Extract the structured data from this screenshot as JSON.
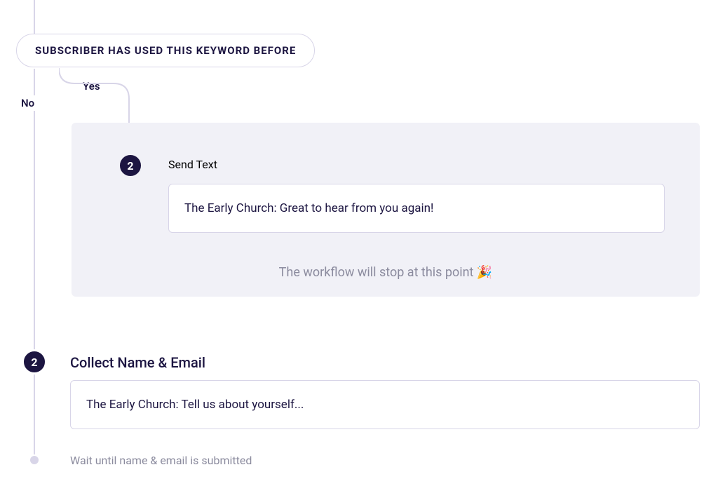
{
  "condition": {
    "label": "SUBSCRIBER HAS USED THIS KEYWORD BEFORE"
  },
  "branches": {
    "no_label": "No",
    "yes_label": "Yes"
  },
  "yes_branch": {
    "step_number": "2",
    "step_title": "Send Text",
    "message": "The Early Church: Great to hear from you again!",
    "stop_text": "The workflow will stop at this point 🎉"
  },
  "no_branch": {
    "step_number": "2",
    "step_title": "Collect Name & Email",
    "message": "The Early Church: Tell us about yourself...",
    "wait_text": "Wait until name & email is submitted"
  }
}
